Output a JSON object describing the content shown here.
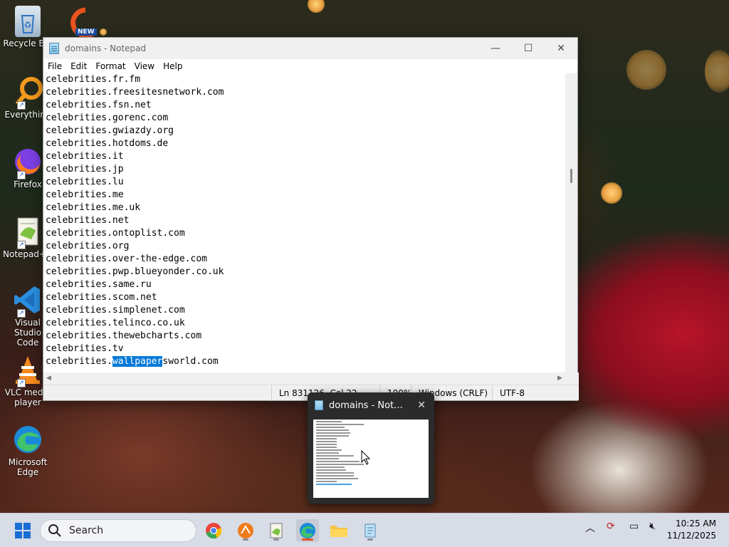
{
  "desktop": {
    "icons": [
      {
        "label": "Recycle Bin",
        "icon": "recycle-bin-icon"
      },
      {
        "label": "Everything",
        "icon": "everything-search-icon"
      },
      {
        "label": "Firefox",
        "icon": "firefox-icon"
      },
      {
        "label": "Notepad++",
        "icon": "notepad-plus-plus-icon"
      },
      {
        "label": "Visual Studio Code",
        "icon": "vscode-icon"
      },
      {
        "label": "VLC media player",
        "icon": "vlc-icon"
      },
      {
        "label": "Microsoft Edge",
        "icon": "edge-icon"
      }
    ],
    "new_app_badge": "NEW"
  },
  "window": {
    "title": "domains - Notepad",
    "minimize": "—",
    "maximize": "☐",
    "close": "✕"
  },
  "menu": {
    "file": "File",
    "edit": "Edit",
    "format": "Format",
    "view": "View",
    "help": "Help"
  },
  "editor": {
    "lines": [
      "celebrities.fr.fm",
      "celebrities.freesitesnetwork.com",
      "celebrities.fsn.net",
      "celebrities.gorenc.com",
      "celebrities.gwiazdy.org",
      "celebrities.hotdoms.de",
      "celebrities.it",
      "celebrities.jp",
      "celebrities.lu",
      "celebrities.me",
      "celebrities.me.uk",
      "celebrities.net",
      "celebrities.ontoplist.com",
      "celebrities.org",
      "celebrities.over-the-edge.com",
      "celebrities.pwp.blueyonder.co.uk",
      "celebrities.same.ru",
      "celebrities.scom.net",
      "celebrities.simplenet.com",
      "celebrities.telinco.co.uk",
      "celebrities.thewebcharts.com",
      "celebrities.tv"
    ],
    "selected_line": {
      "before": "celebrities.",
      "selected": "wallpaper",
      "after": "sworld.com"
    }
  },
  "statusbar": {
    "position": "Ln 831126, Col 22",
    "zoom": "100%",
    "line_ending": "Windows (CRLF)",
    "encoding": "UTF-8"
  },
  "preview": {
    "title": "domains - Not...",
    "close": "✕"
  },
  "taskbar": {
    "search_placeholder": "Search",
    "time": "10:25 AM",
    "date": "11/12/2025"
  },
  "colors": {
    "selection": "#0078d7",
    "taskbar_bg": "#d7dce6"
  }
}
